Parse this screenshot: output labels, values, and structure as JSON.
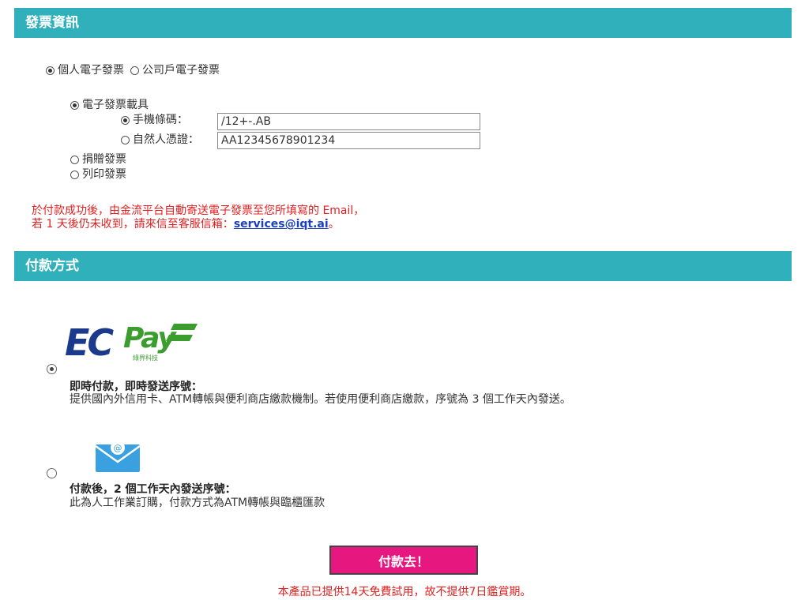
{
  "invoice": {
    "header": "發票資訊",
    "type_personal": "個人電子發票",
    "type_company": "公司戶電子發票",
    "carrier_label": "電子發票載具",
    "mobile_label": "手機條碼：",
    "mobile_value": "/12+-.AB",
    "citizen_label": "自然人憑證：",
    "citizen_value": "AA12345678901234",
    "donate_label": "捐贈發票",
    "print_label": "列印發票",
    "notice_line1": "於付款成功後，由金流平台自動寄送電子發票至您所填寫的 Email，",
    "notice_line2_prefix": "若 1 天後仍未收到，請來信至客服信箱：",
    "notice_email": "services@iqt.ai",
    "notice_line2_suffix": "。"
  },
  "payment": {
    "header": "付款方式",
    "ecpay_logo_text": "ECPay",
    "ecpay_logo_sub": "綠界科技",
    "ecpay_title": "即時付款，即時發送序號：",
    "ecpay_desc": "提供國內外信用卡、ATM轉帳與便利商店繳款機制。若使用便利商店繳款，序號為 3 個工作天內發送。",
    "manual_title": "付款後，2 個工作天內發送序號：",
    "manual_desc": "此為人工作業訂購，付款方式為ATM轉帳與臨櫃匯款",
    "submit_label": "付款去！",
    "footnote": "本產品已提供14天免費試用，故不提供7日鑑賞期。"
  },
  "colors": {
    "header_bg": "#2fb0bb",
    "submit_bg": "#e6177f",
    "notice": "#e02020",
    "link": "#1a3fbf"
  }
}
